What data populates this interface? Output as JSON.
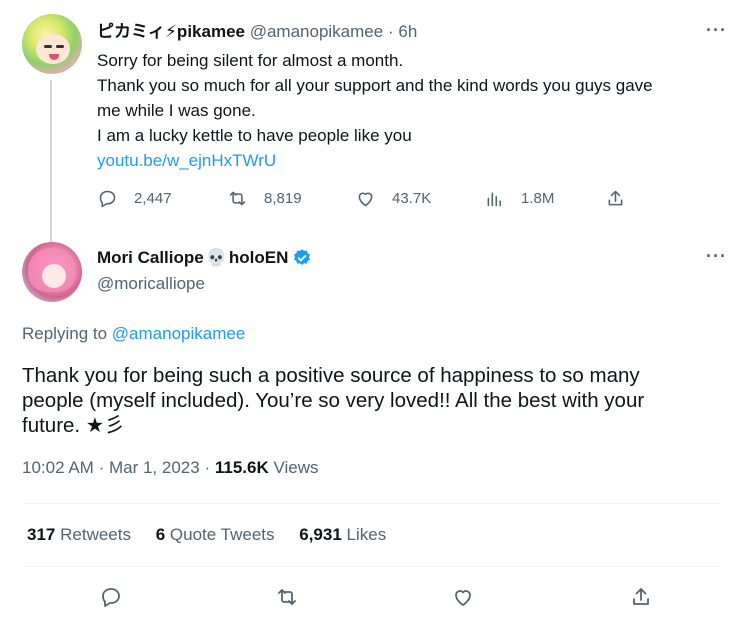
{
  "parent_tweet": {
    "display_name": "ピカミィ⚡pikamee",
    "handle": "@amanopikamee",
    "separator": "·",
    "time": "6h",
    "more_label": "···",
    "lines": [
      "Sorry for being silent for almost a month.",
      "Thank you so much for all your support and the kind words you guys gave",
      "me while I was gone.",
      "I am a lucky kettle to have people like you"
    ],
    "link": "youtu.be/w_ejnHxTWrU",
    "replies": "2,447",
    "retweets": "8,819",
    "likes": "43.7K",
    "views": "1.8M"
  },
  "main_tweet": {
    "display_name": "Mori Calliope",
    "name_emoji": "💀",
    "name_suffix": "holoEN",
    "handle": "@moricalliope",
    "more_label": "···",
    "replying_prefix": "Replying to",
    "replying_to": "@amanopikamee",
    "lines": [
      "Thank you for being such a positive source of happiness to so many",
      "people (myself included). You’re so very loved!! All the best with your",
      "future. ★彡"
    ],
    "time": "10:02 AM",
    "date": "Mar 1, 2023",
    "separator": "·",
    "views_count": "115.6K",
    "views_label": "Views",
    "retweets_count": "317",
    "retweets_label": "Retweets",
    "quotes_count": "6",
    "quotes_label": "Quote Tweets",
    "likes_count": "6,931",
    "likes_label": "Likes"
  },
  "colors": {
    "link": "#1d9bf0",
    "secondary_text": "#536471",
    "primary_text": "#0f1419",
    "verified": "#1d9bf0",
    "divider": "#eff3f4"
  }
}
